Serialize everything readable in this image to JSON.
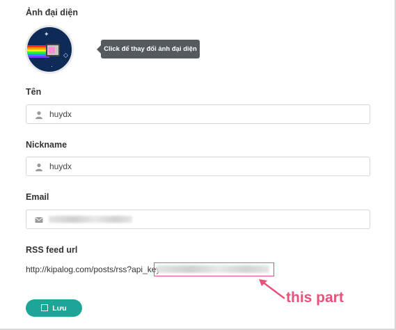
{
  "avatar_section": {
    "label": "Ảnh đại diện",
    "tooltip": "Click để thay đổi ảnh đại diện",
    "background_color": "#0e2a57"
  },
  "name_field": {
    "label": "Tên",
    "value": "huydx",
    "icon": "user-icon"
  },
  "nickname_field": {
    "label": "Nickname",
    "value": "huydx",
    "icon": "user-icon"
  },
  "email_field": {
    "label": "Email",
    "value_state": "blurred",
    "icon": "envelope-icon"
  },
  "rss": {
    "label": "RSS feed url",
    "url_prefix": "http://kipalog.com/posts/rss?api_key=",
    "api_key_state": "blurred",
    "highlight_color": "#e6527a"
  },
  "save_button": {
    "label": "Lưu",
    "icon": "save-icon",
    "color": "#1fa598"
  },
  "annotation": {
    "text": "this part",
    "color": "#e6527a"
  }
}
